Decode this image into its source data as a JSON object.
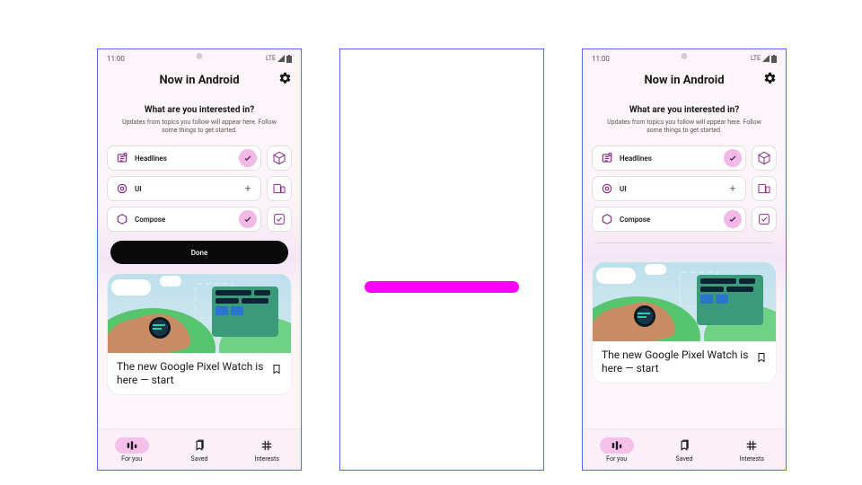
{
  "status": {
    "time": "11:00",
    "net": "LTE"
  },
  "app_title": "Now in Android",
  "onboard": {
    "question": "What are you interested in?",
    "subtitle": "Updates from topics you follow will appear here. Follow some things to get started."
  },
  "topics": [
    {
      "label": "Headlines",
      "selected": true,
      "icon": "headlines",
      "author_icon": "cube"
    },
    {
      "label": "UI",
      "selected": false,
      "icon": "ui",
      "author_icon": "devices"
    },
    {
      "label": "Compose",
      "selected": true,
      "icon": "compose",
      "author_icon": "check"
    }
  ],
  "done_label": "Done",
  "card": {
    "title": "The new Google Pixel Watch is here  — start"
  },
  "nav": [
    {
      "label": "For you",
      "active": true,
      "icon": "foryou"
    },
    {
      "label": "Saved",
      "active": false,
      "icon": "saved"
    },
    {
      "label": "Interests",
      "active": false,
      "icon": "grid"
    }
  ]
}
